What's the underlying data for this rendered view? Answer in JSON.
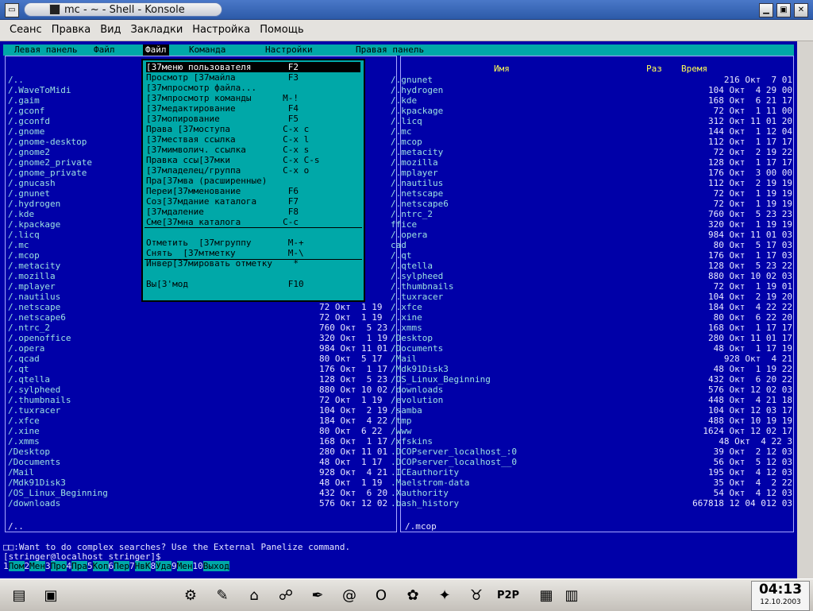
{
  "window": {
    "title": "mc - ~ - Shell - Konsole"
  },
  "menubar": [
    "Сеанс",
    "Правка",
    "Вид",
    "Закладки",
    "Настройка",
    "Помощь"
  ],
  "mc_top": {
    "left": "Левая панель",
    "file": "Файл",
    "cmd": "Команда",
    "settings": "Настройки",
    "right": "Правая панель"
  },
  "left_panel": {
    "files": [
      "/..",
      "/.WaveToMidi",
      "/.gaim",
      "/.gconf",
      "/.gconfd",
      "/.gnome",
      "/.gnome-desktop",
      "/.gnome2",
      "/.gnome2_private",
      "/.gnome_private",
      "/.gnucash",
      "/.gnunet",
      "/.hydrogen",
      "/.kde",
      "/.kpackage",
      "/.licq",
      "/.mc",
      "/.mcop",
      "/.metacity",
      "/.mozilla",
      "/.mplayer",
      "/.nautilus",
      "/.netscape",
      "/.netscape6",
      "/.ntrc_2",
      "/.openoffice",
      "/.opera",
      "/.qcad",
      "/.qt",
      "/.qtella",
      "/.sylpheed",
      "/.thumbnails",
      "/.tuxracer",
      "/.xfce",
      "/.xine",
      "/.xmms",
      "/Desktop",
      "/Documents",
      "/Mail",
      "/Mdk91Disk3",
      "/OS_Linux_Beginning",
      "/downloads"
    ],
    "info": [
      "72 Окт  1 19",
      "72 Окт  1 19",
      "760 Окт  5 23",
      "320 Окт  1 19",
      "984 Окт 11 01",
      "80 Окт  5 17",
      "176 Окт  1 17",
      "128 Окт  5 23",
      "880 Окт 10 02",
      "72 Окт  1 19",
      "104 Окт  2 19",
      "184 Окт  4 22",
      "80 Окт  6 22",
      "168 Окт  1 17",
      "280 Окт 11 01",
      "48 Окт  1 17",
      "928 Окт  4 21",
      "48 Окт  1 19",
      "432 Окт  6 20",
      "576 Окт 12 02"
    ],
    "status": "/.."
  },
  "right_panel": {
    "headers": {
      "name": "Имя",
      "size": "Раз",
      "time": "Время"
    },
    "files": [
      "/.gnunet",
      "/.hydrogen",
      "/.kde",
      "/.kpackage",
      "/.licq",
      "/.mc",
      "/.mcop",
      "/.metacity",
      "/.mozilla",
      "/.mplayer",
      "/.nautilus",
      "/.netscape",
      "/.netscape6",
      "/.ntrc_2",
      "ffice",
      "/.opera",
      "cad",
      "/.qt",
      "/.qtella",
      "/.sylpheed",
      "/.thumbnails",
      "/.tuxracer",
      "/.xfce",
      "/.xine",
      "/.xmms",
      "/Desktop",
      "/Documents",
      "/Mail",
      "/Mdk91Disk3",
      "/OS_Linux_Beginning",
      "/downloads",
      "/evolution",
      "/samba",
      "/tmp",
      "/www",
      "/xfskins",
      ".DCOPserver_localhost_:0",
      ".DCOPserver_localhost__0",
      ".ICEauthority",
      ".Maelstrom-data",
      ".Xauthority",
      ".bash_history"
    ],
    "info": [
      "216 Окт  7 01",
      "104 Окт  4 29 00",
      "168 Окт  6 21 17",
      "72 Окт  1 11 00",
      "312 Окт 11 01 20",
      "144 Окт  1 12 04",
      "112 Окт  1 17 17",
      "72 Окт  2 19 22",
      "128 Окт  1 17 17",
      "176 Окт  3 00 00",
      "112 Окт  2 19 19",
      "72 Окт  1 19 19",
      "72 Окт  1 19 19",
      "760 Окт  5 23 23",
      "320 Окт  1 19 19",
      "984 Окт 11 01 03",
      "80 Окт  5 17 03",
      "176 Окт  1 17 03",
      "128 Окт  5 23 22",
      "880 Окт 10 02 03",
      "72 Окт  1 19 01",
      "104 Окт  2 19 20",
      "184 Окт  4 22 22",
      "80 Окт  6 22 20",
      "168 Окт  1 17 17",
      "280 Окт 11 01 17",
      "48 Окт  1 17 19",
      "928 Окт  4 21",
      "48 Окт  1 19 22",
      "432 Окт  6 20 22",
      "576 Окт 12 02 03",
      "448 Окт  4 21 18",
      "104 Окт 12 03 17",
      "488 Окт 10 19 19",
      "1624 Окт 12 02 17",
      "48 Окт  4 22 3",
      "39 Окт  2 12 03",
      "56 Окт  5 12 03",
      "195 Окт  4 12 03",
      "35 Окт  4  2 22",
      "54 Окт  4 12 03",
      "667818 12 04 012 03"
    ],
    "status": "/.mcop"
  },
  "file_menu": {
    "items": [
      "[37меню пользователя       F2",
      "Просмотр [37майла          F3",
      "[37мпросмотр файла...",
      "[37мпросмотр команды      M-!",
      "[37медактирование          F4",
      "[37мопирование             F5",
      "Права [37моступа          C-x c",
      "[37мествая ссылка         C-x l",
      "[37мимволич. ссылка       C-x s",
      "Правка ссы[37мки          C-x C-s",
      "[37младелец/группа        C-x o",
      "Пра[37мва (расширенные)",
      "Переи[37мменование         F6",
      "Соз[37мдание каталога      F7",
      "[37мдаление                F8",
      "Сме[37мна каталога        C-c",
      "Отметить  [37мгруппу       M-+",
      "Снять  [37мтметку          M-\\",
      "Инвер[37мировать отметку    *",
      "Вы[3'мод                   F10"
    ]
  },
  "cmdline": {
    "hint": "Want to do complex searches? Use the External Panelize command.",
    "prompt": "[stringer@localhost stringer]$"
  },
  "fkeys": [
    {
      "n": "1",
      "l": "Пом"
    },
    {
      "n": "2",
      "l": "Мен"
    },
    {
      "n": "3",
      "l": "Про"
    },
    {
      "n": "4",
      "l": "Пра"
    },
    {
      "n": "5",
      "l": "Коп"
    },
    {
      "n": "6",
      "l": "Пер"
    },
    {
      "n": "7",
      "l": "НвК"
    },
    {
      "n": "8",
      "l": "Уда"
    },
    {
      "n": "9",
      "l": "Мен"
    },
    {
      "n": "10",
      "l": "Выход"
    }
  ],
  "clock": {
    "time": "04:13",
    "date": "12.10.2003"
  }
}
